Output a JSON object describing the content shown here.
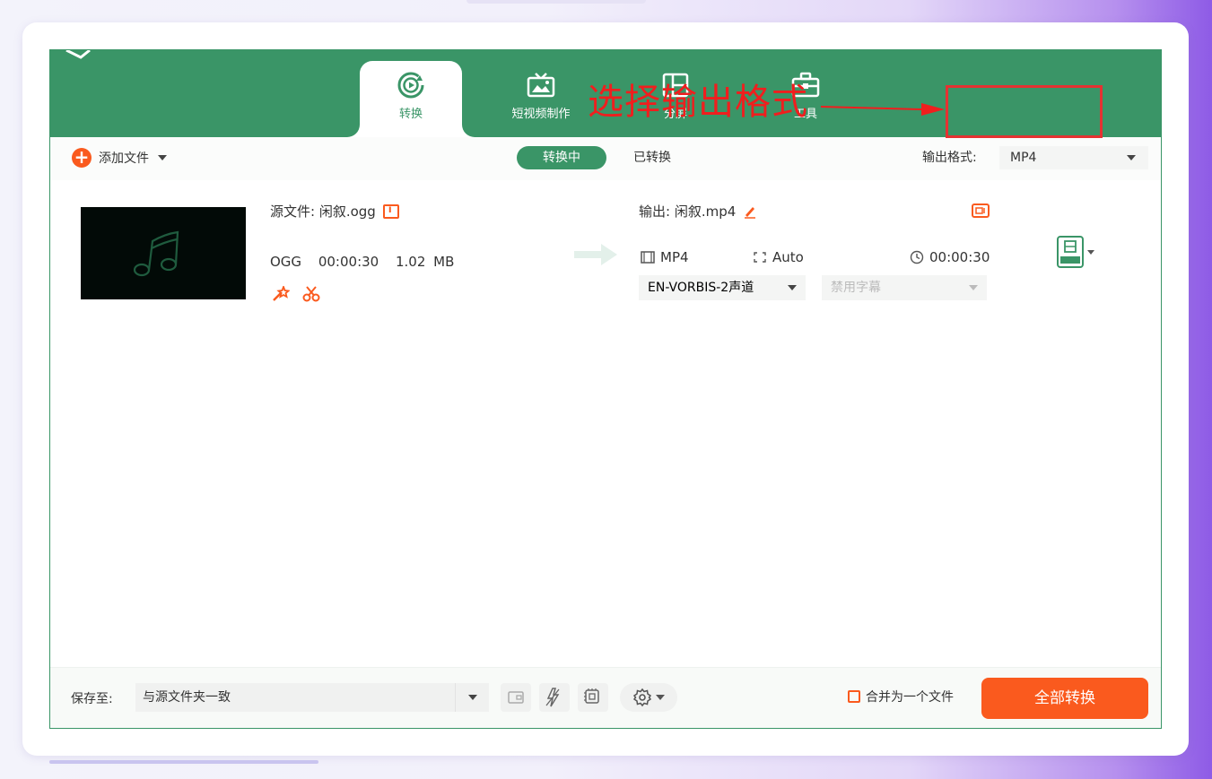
{
  "tabs": [
    {
      "label": "转换",
      "icon": "convert-icon",
      "active": true
    },
    {
      "label": "短视频制作",
      "icon": "tv-icon",
      "active": false
    },
    {
      "label": "分屏",
      "icon": "split-screen-icon",
      "active": false
    },
    {
      "label": "工具",
      "icon": "toolbox-icon",
      "active": false
    }
  ],
  "toolbar": {
    "add_file_label": "添加文件",
    "status_converting": "转换中",
    "status_done": "已转换",
    "output_format_label": "输出格式:",
    "output_format_value": "MP4"
  },
  "annotation": {
    "text": "选择输出格式",
    "color": "#f01e1e"
  },
  "file": {
    "source_label": "源文件: 闲叙.ogg",
    "format": "OGG",
    "duration": "00:00:30",
    "size": "1.02 MB",
    "output_label": "输出: 闲叙.mp4",
    "out_format": "MP4",
    "out_resolution": "Auto",
    "out_duration": "00:00:30",
    "audio_track": "EN-VORBIS-2声道",
    "subtitle": "禁用字幕"
  },
  "footer": {
    "save_to_label": "保存至:",
    "save_path": "与源文件夹一致",
    "merge_label": "合并为一个文件",
    "convert_all_label": "全部转换"
  },
  "colors": {
    "brand_green": "#3a9567",
    "accent_orange": "#fa5a1e"
  }
}
